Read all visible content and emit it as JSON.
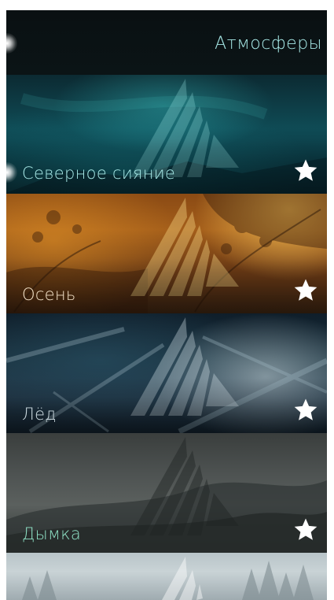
{
  "header": {
    "title": "Атмосферы"
  },
  "ambiences": [
    {
      "name": "Северное сияние",
      "favorite": true,
      "selected": true
    },
    {
      "name": "Осень",
      "favorite": true,
      "selected": false
    },
    {
      "name": "Лёд",
      "favorite": true,
      "selected": false
    },
    {
      "name": "Дымка",
      "favorite": true,
      "selected": false
    }
  ],
  "icons": {
    "favorite": "star-icon",
    "ambience_logo": "sailfish-triangle-logo",
    "highlight": "glow-indicator"
  },
  "colors": {
    "highlight_text": "#a6e8e6",
    "primary_text": "#ffffff",
    "header_bg": "#0a1012",
    "star": "#ffffff"
  }
}
